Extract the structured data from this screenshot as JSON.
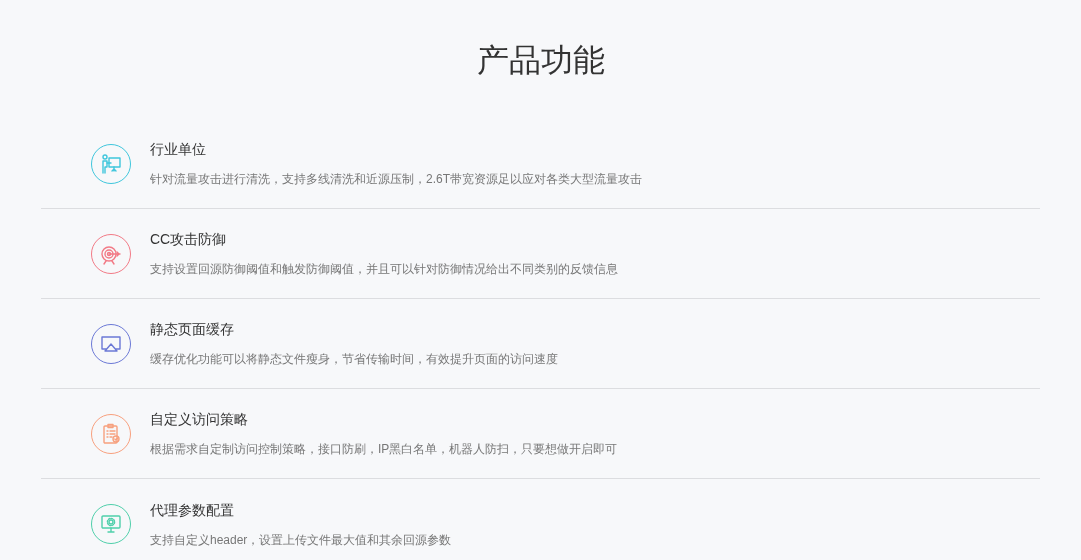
{
  "heading": "产品功能",
  "features": [
    {
      "title": "行业单位",
      "description": "针对流量攻击进行清洗，支持多线清洗和近源压制，2.6T带宽资源足以应对各类大型流量攻击",
      "kind": "presenter",
      "color": "#3fc6dc"
    },
    {
      "title": "CC攻击防御",
      "description": "支持设置回源防御阈值和触发防御阈值，并且可以针对防御情况给出不同类别的反馈信息",
      "kind": "target",
      "color": "#f27a86"
    },
    {
      "title": "静态页面缓存",
      "description": "缓存优化功能可以将静态文件瘦身，节省传输时间，有效提升页面的访问速度",
      "kind": "screen",
      "color": "#6b78d6"
    },
    {
      "title": "自定义访问策略",
      "description": "根据需求自定制访问控制策略，接口防刷，IP黑白名单，机器人防扫，只要想做开启即可",
      "kind": "clipboard",
      "color": "#f7a07e"
    },
    {
      "title": "代理参数配置",
      "description": "支持自定义header，设置上传文件最大值和其余回源参数",
      "kind": "monitor",
      "color": "#4fcfaa"
    }
  ]
}
